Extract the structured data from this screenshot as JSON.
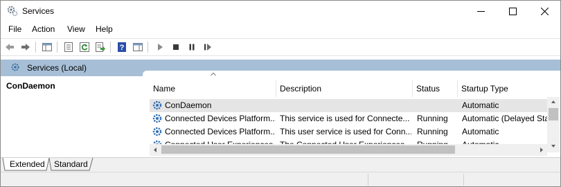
{
  "window": {
    "title": "Services",
    "icon": "services-gear-icon",
    "controls": [
      "minimize-icon",
      "maximize-icon",
      "close-icon"
    ]
  },
  "menu": {
    "items": [
      "File",
      "Action",
      "View",
      "Help"
    ]
  },
  "toolbar": {
    "buttons": [
      "back-arrow-icon",
      "forward-arrow-icon",
      "show-hide-console-tree-icon",
      "properties-icon",
      "refresh-icon",
      "export-list-icon",
      "help-icon",
      "show-hide-action-pane-icon",
      "start-service-icon",
      "stop-service-icon",
      "pause-service-icon",
      "restart-service-icon"
    ]
  },
  "header_band": {
    "title": "Services (Local)",
    "icon": "services-gear-icon"
  },
  "left_pane": {
    "selected_service": "ConDaemon"
  },
  "table": {
    "columns": [
      "Name",
      "Description",
      "Status",
      "Startup Type"
    ],
    "sorted_column": "Name",
    "rows": [
      {
        "name": "ConDaemon",
        "description": "",
        "status": "",
        "startup": "Automatic"
      },
      {
        "name": "Connected Devices Platform...",
        "description": "This service is used for Connecte...",
        "status": "Running",
        "startup": "Automatic (Delayed Sta"
      },
      {
        "name": "Connected Devices Platform...",
        "description": "This user service is used for Conn...",
        "status": "Running",
        "startup": "Automatic"
      },
      {
        "name": "Connected User Experiences...",
        "description": "The Connected User Experiences ...",
        "status": "Running",
        "startup": "Automatic"
      }
    ]
  },
  "tabs": {
    "items": [
      "Extended",
      "Standard"
    ],
    "active": "Extended"
  },
  "colors": {
    "header_band": "#a7bfd6",
    "selected_row": "#e5e5e5",
    "icon_blue": "#2f6fb5"
  }
}
